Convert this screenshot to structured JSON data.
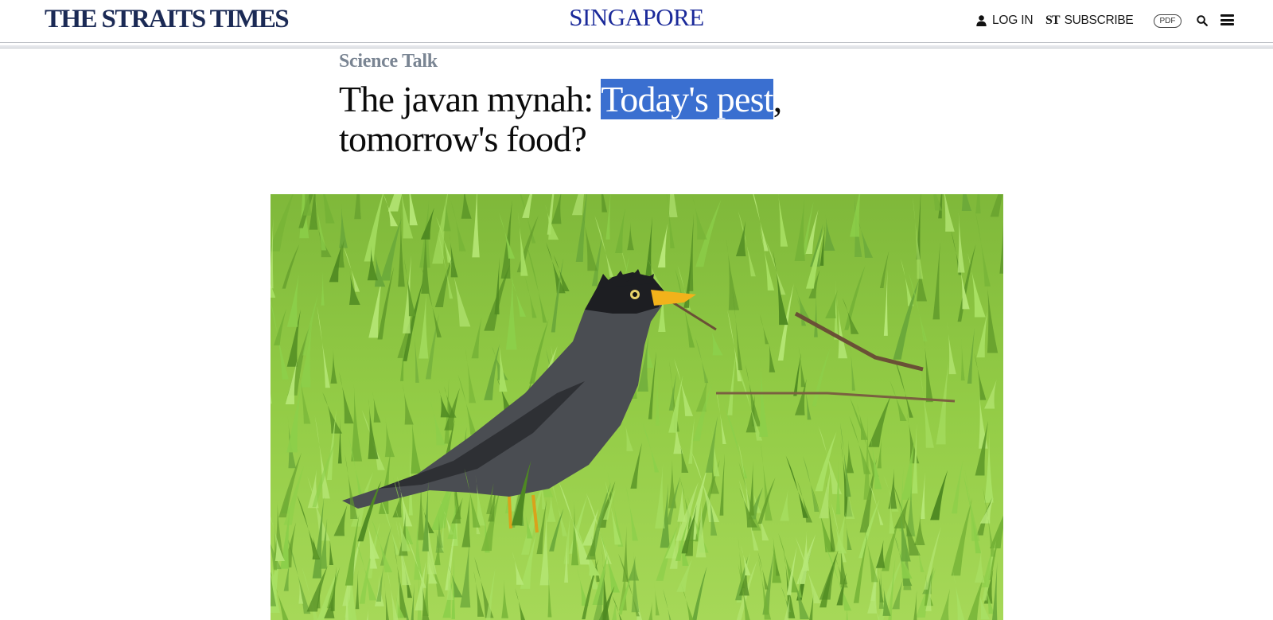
{
  "header": {
    "logo_text": "THE STRAITS TIMES",
    "section": "SINGAPORE",
    "login_label": "LOG IN",
    "subscribe_mark": "ST",
    "subscribe_label": "SUBSCRIBE",
    "pdf_label": "PDF",
    "icons": [
      "user-icon",
      "search-icon",
      "menu-icon"
    ]
  },
  "article": {
    "kicker": "Science Talk",
    "headline_before": "The javan mynah: ",
    "headline_selected": "Today's pest",
    "headline_after": ", tomorrow's food?",
    "image_subject": "javan-mynah-photo"
  },
  "colors": {
    "brand_navy": "#1b2a55",
    "section_blue": "#1b2a9a",
    "kicker_grey": "#7a8593",
    "selection_blue": "#3a6fd0"
  }
}
